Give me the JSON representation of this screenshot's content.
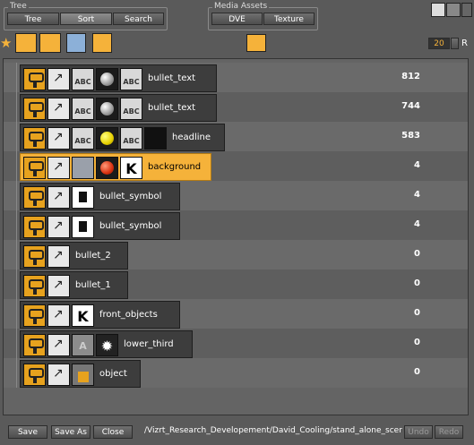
{
  "toolbar": {
    "tree_group_label": "Tree",
    "tree_tab": "Tree",
    "sort_tab": "Sort",
    "search_tab": "Search",
    "media_group_label": "Media Assets",
    "dve_tab": "DVE",
    "texture_tab": "Texture",
    "zoom_value": "20",
    "zoom_suffix": "R"
  },
  "rows": [
    {
      "name": "bullet_text",
      "value": "812",
      "icons": [
        "camera-icon",
        "axis-icon",
        "text-abc-icon",
        "sphere-icon",
        "text-abc-icon"
      ]
    },
    {
      "name": "bullet_text",
      "value": "744",
      "icons": [
        "camera-icon",
        "axis-icon",
        "text-abc-icon",
        "sphere-icon",
        "text-abc-icon"
      ]
    },
    {
      "name": "headline",
      "value": "583",
      "icons": [
        "camera-icon",
        "axis-icon",
        "text-abc-icon",
        "yellow-sphere-icon",
        "text-abc-icon",
        "container-icon"
      ]
    },
    {
      "name": "background",
      "value": "4",
      "selected": true,
      "icons": [
        "camera-icon",
        "axis-icon",
        "rectangle-icon",
        "red-sphere-icon",
        "key-icon"
      ]
    },
    {
      "name": "bullet_symbol",
      "value": "4",
      "icons": [
        "camera-icon",
        "axis-icon",
        "symbol-icon"
      ]
    },
    {
      "name": "bullet_symbol",
      "value": "4",
      "icons": [
        "camera-icon",
        "axis-icon",
        "symbol-icon"
      ]
    },
    {
      "name": "bullet_2",
      "value": "0",
      "icons": [
        "camera-icon",
        "axis-icon"
      ]
    },
    {
      "name": "bullet_1",
      "value": "0",
      "icons": [
        "camera-icon",
        "axis-icon"
      ]
    },
    {
      "name": "front_objects",
      "value": "0",
      "icons": [
        "camera-icon",
        "axis-icon",
        "key-icon"
      ]
    },
    {
      "name": "lower_third",
      "value": "0",
      "icons": [
        "camera-icon",
        "axis-icon",
        "alpha-icon",
        "anim-icon"
      ]
    },
    {
      "name": "object",
      "value": "0",
      "icons": [
        "camera-icon",
        "axis-icon",
        "object-icon"
      ]
    }
  ],
  "footer": {
    "save": "Save",
    "save_as": "Save As",
    "close": "Close",
    "path": "/Vizrt_Research_Developement/David_Cooling/stand_alone_scene/s",
    "undo": "Undo",
    "redo": "Redo"
  },
  "colors": {
    "accent": "#f5b23a",
    "background": "#5a5a5a"
  }
}
